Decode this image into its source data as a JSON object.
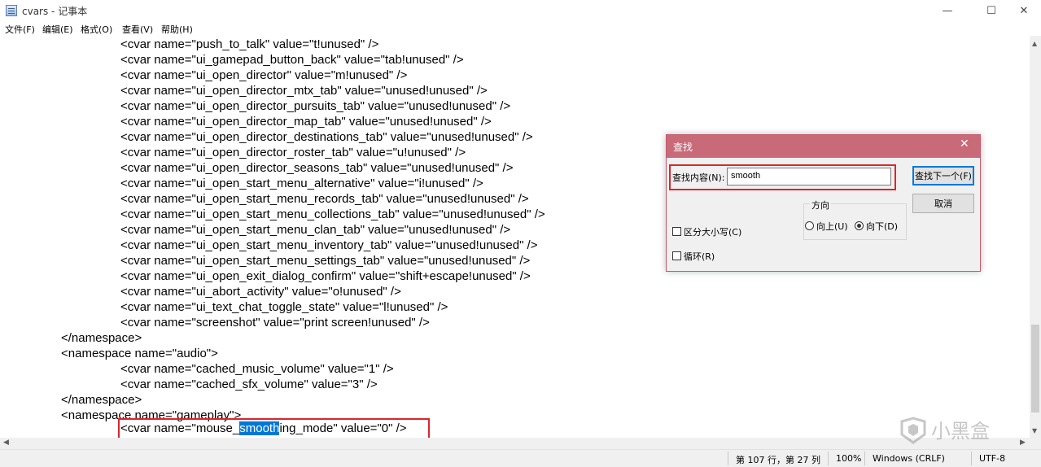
{
  "window": {
    "title": "cvars - 记事本",
    "min_glyph": "—",
    "max_glyph": "☐",
    "close_glyph": "✕"
  },
  "menu": [
    "文件(F)",
    "编辑(E)",
    "格式(O)",
    "查看(V)",
    "帮助(H)"
  ],
  "lines": [
    {
      "indent": 2,
      "text": "<cvar name=\"push_to_talk\" value=\"t!unused\" />"
    },
    {
      "indent": 2,
      "text": "<cvar name=\"ui_gamepad_button_back\" value=\"tab!unused\" />"
    },
    {
      "indent": 2,
      "text": "<cvar name=\"ui_open_director\" value=\"m!unused\" />"
    },
    {
      "indent": 2,
      "text": "<cvar name=\"ui_open_director_mtx_tab\" value=\"unused!unused\" />"
    },
    {
      "indent": 2,
      "text": "<cvar name=\"ui_open_director_pursuits_tab\" value=\"unused!unused\" />"
    },
    {
      "indent": 2,
      "text": "<cvar name=\"ui_open_director_map_tab\" value=\"unused!unused\" />"
    },
    {
      "indent": 2,
      "text": "<cvar name=\"ui_open_director_destinations_tab\" value=\"unused!unused\" />"
    },
    {
      "indent": 2,
      "text": "<cvar name=\"ui_open_director_roster_tab\" value=\"u!unused\" />"
    },
    {
      "indent": 2,
      "text": "<cvar name=\"ui_open_director_seasons_tab\" value=\"unused!unused\" />"
    },
    {
      "indent": 2,
      "text": "<cvar name=\"ui_open_start_menu_alternative\" value=\"i!unused\" />"
    },
    {
      "indent": 2,
      "text": "<cvar name=\"ui_open_start_menu_records_tab\" value=\"unused!unused\" />"
    },
    {
      "indent": 2,
      "text": "<cvar name=\"ui_open_start_menu_collections_tab\" value=\"unused!unused\" />"
    },
    {
      "indent": 2,
      "text": "<cvar name=\"ui_open_start_menu_clan_tab\" value=\"unused!unused\" />"
    },
    {
      "indent": 2,
      "text": "<cvar name=\"ui_open_start_menu_inventory_tab\" value=\"unused!unused\" />"
    },
    {
      "indent": 2,
      "text": "<cvar name=\"ui_open_start_menu_settings_tab\" value=\"unused!unused\" />"
    },
    {
      "indent": 2,
      "text": "<cvar name=\"ui_open_exit_dialog_confirm\" value=\"shift+escape!unused\" />"
    },
    {
      "indent": 2,
      "text": "<cvar name=\"ui_abort_activity\" value=\"o!unused\" />"
    },
    {
      "indent": 2,
      "text": "<cvar name=\"ui_text_chat_toggle_state\" value=\"l!unused\" />"
    },
    {
      "indent": 2,
      "text": "<cvar name=\"screenshot\" value=\"print screen!unused\" />"
    },
    {
      "indent": 1,
      "text": "</namespace>"
    },
    {
      "indent": 1,
      "text": "<namespace name=\"audio\">"
    },
    {
      "indent": 2,
      "text": "<cvar name=\"cached_music_volume\" value=\"1\" />"
    },
    {
      "indent": 2,
      "text": "<cvar name=\"cached_sfx_volume\" value=\"3\" />"
    },
    {
      "indent": 1,
      "text": "</namespace>"
    },
    {
      "indent": 1,
      "text": "<namespace name=\"gameplay\">"
    }
  ],
  "highlight_line": {
    "before": "<cvar name=\"mouse_",
    "match": "smooth",
    "after": "ing_mode\" value=\"0\" />"
  },
  "status": {
    "position": "第 107 行，第 27 列",
    "zoom": "100%",
    "line_ending": "Windows (CRLF)",
    "encoding": "UTF-8"
  },
  "find_dialog": {
    "title": "查找",
    "close_glyph": "✕",
    "find_label": "查找内容(N):",
    "find_value": "smooth",
    "find_next": "查找下一个(F)",
    "cancel": "取消",
    "direction_label": "方向",
    "up": "向上(U)",
    "down": "向下(D)",
    "direction_selected": "down",
    "match_case": "区分大小写(C)",
    "wrap": "循环(R)"
  },
  "watermark": "小黑盒",
  "colors": {
    "selection": "#0078d7",
    "annotation_red": "#d9262c",
    "dialog_title": "#c96a78"
  }
}
